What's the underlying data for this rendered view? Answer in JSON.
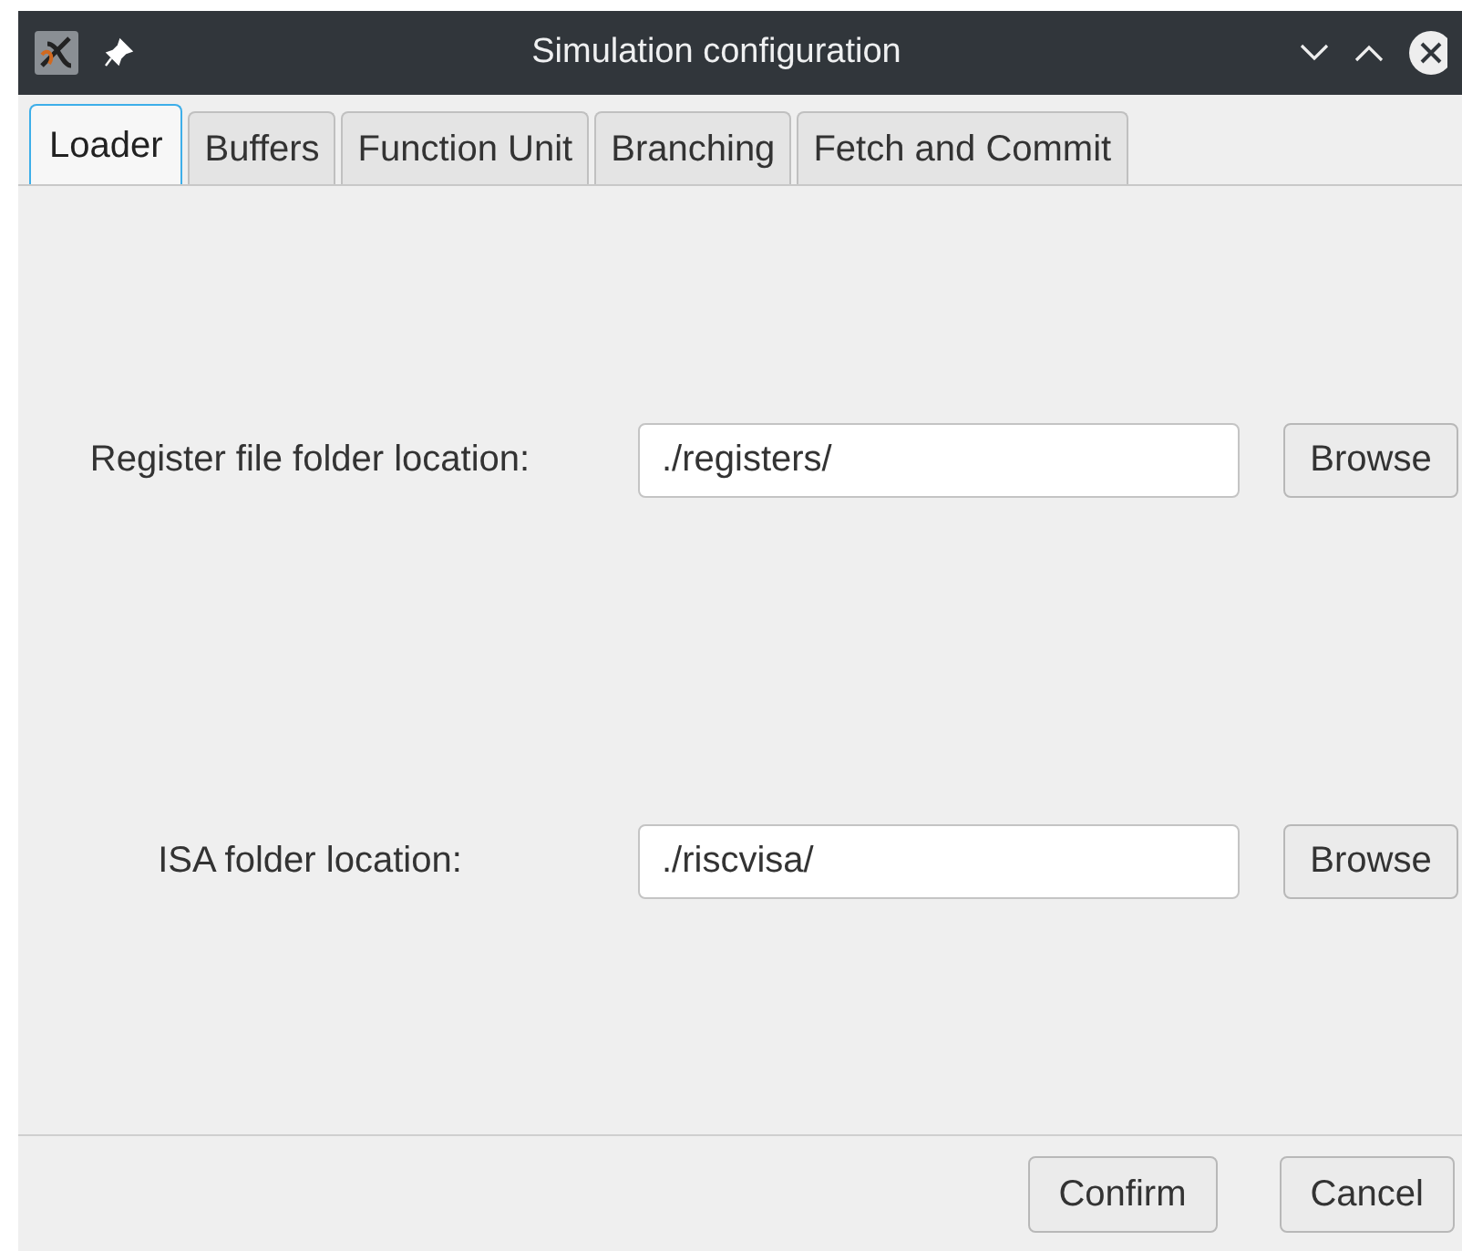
{
  "window": {
    "title": "Simulation configuration"
  },
  "tabs": [
    {
      "label": "Loader",
      "selected": true
    },
    {
      "label": "Buffers",
      "selected": false
    },
    {
      "label": "Function Unit",
      "selected": false
    },
    {
      "label": "Branching",
      "selected": false
    },
    {
      "label": "Fetch and Commit",
      "selected": false
    }
  ],
  "fields": [
    {
      "label": "Register file folder location:",
      "value": "./registers/",
      "button": "Browse"
    },
    {
      "label": "ISA folder location:",
      "value": "./riscvisa/",
      "button": "Browse"
    }
  ],
  "buttons": [
    "Confirm",
    "Cancel"
  ]
}
